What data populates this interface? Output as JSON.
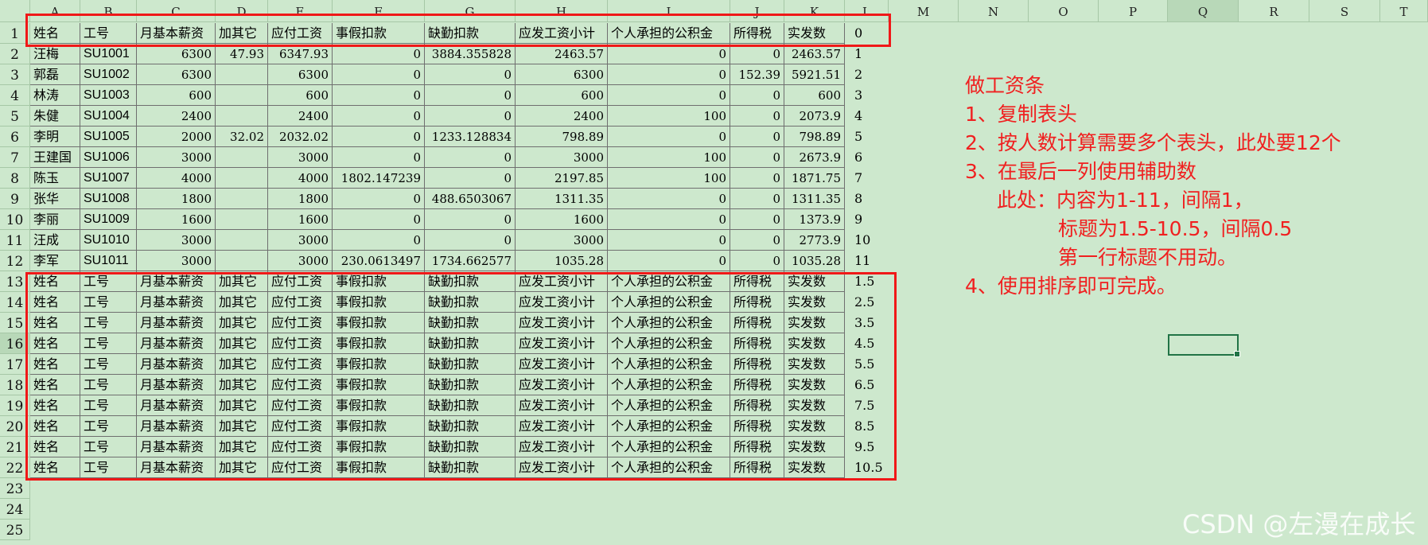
{
  "sheet": {
    "column_headers": [
      "A",
      "B",
      "C",
      "D",
      "E",
      "F",
      "G",
      "H",
      "I",
      "J",
      "K",
      "L",
      "M",
      "N",
      "O",
      "P",
      "Q",
      "R",
      "S",
      "T"
    ],
    "selected_column": "Q",
    "row_numbers": [
      "1",
      "2",
      "3",
      "4",
      "5",
      "6",
      "7",
      "8",
      "9",
      "10",
      "11",
      "12",
      "13",
      "14",
      "15",
      "16",
      "17",
      "18",
      "19",
      "20",
      "21",
      "22",
      "23",
      "24",
      "25"
    ],
    "selected_row": "16",
    "header_labels": [
      "姓名",
      "工号",
      "月基本薪资",
      "加其它",
      "应付工资",
      "事假扣款",
      "缺勤扣款",
      "应发工资小计",
      "个人承担的公积金",
      "所得税",
      "实发数"
    ],
    "data_rows": [
      {
        "name": "汪梅",
        "id": "SU1001",
        "base": "6300",
        "other": "47.93",
        "payable": "6347.93",
        "leave": "0",
        "absence": "3884.355828",
        "subtotal": "2463.57",
        "fund": "0",
        "tax": "0",
        "net": "2463.57"
      },
      {
        "name": "郭磊",
        "id": "SU1002",
        "base": "6300",
        "other": "",
        "payable": "6300",
        "leave": "0",
        "absence": "0",
        "subtotal": "6300",
        "fund": "0",
        "tax": "152.39",
        "net": "5921.51"
      },
      {
        "name": "林涛",
        "id": "SU1003",
        "base": "600",
        "other": "",
        "payable": "600",
        "leave": "0",
        "absence": "0",
        "subtotal": "600",
        "fund": "0",
        "tax": "0",
        "net": "600"
      },
      {
        "name": "朱健",
        "id": "SU1004",
        "base": "2400",
        "other": "",
        "payable": "2400",
        "leave": "0",
        "absence": "0",
        "subtotal": "2400",
        "fund": "100",
        "tax": "0",
        "net": "2073.9"
      },
      {
        "name": "李明",
        "id": "SU1005",
        "base": "2000",
        "other": "32.02",
        "payable": "2032.02",
        "leave": "0",
        "absence": "1233.128834",
        "subtotal": "798.89",
        "fund": "0",
        "tax": "0",
        "net": "798.89"
      },
      {
        "name": "王建国",
        "id": "SU1006",
        "base": "3000",
        "other": "",
        "payable": "3000",
        "leave": "0",
        "absence": "0",
        "subtotal": "3000",
        "fund": "100",
        "tax": "0",
        "net": "2673.9"
      },
      {
        "name": "陈玉",
        "id": "SU1007",
        "base": "4000",
        "other": "",
        "payable": "4000",
        "leave": "1802.147239",
        "absence": "0",
        "subtotal": "2197.85",
        "fund": "100",
        "tax": "0",
        "net": "1871.75"
      },
      {
        "name": "张华",
        "id": "SU1008",
        "base": "1800",
        "other": "",
        "payable": "1800",
        "leave": "0",
        "absence": "488.6503067",
        "subtotal": "1311.35",
        "fund": "0",
        "tax": "0",
        "net": "1311.35"
      },
      {
        "name": "李丽",
        "id": "SU1009",
        "base": "1600",
        "other": "",
        "payable": "1600",
        "leave": "0",
        "absence": "0",
        "subtotal": "1600",
        "fund": "0",
        "tax": "0",
        "net": "1373.9"
      },
      {
        "name": "汪成",
        "id": "SU1010",
        "base": "3000",
        "other": "",
        "payable": "3000",
        "leave": "0",
        "absence": "0",
        "subtotal": "3000",
        "fund": "0",
        "tax": "0",
        "net": "2773.9"
      },
      {
        "name": "李军",
        "id": "SU1011",
        "base": "3000",
        "other": "",
        "payable": "3000",
        "leave": "230.0613497",
        "absence": "1734.662577",
        "subtotal": "1035.28",
        "fund": "0",
        "tax": "0",
        "net": "1035.28"
      }
    ],
    "aux_column": [
      "0",
      "1",
      "2",
      "3",
      "4",
      "5",
      "6",
      "7",
      "8",
      "9",
      "10",
      "11",
      "1.5",
      "2.5",
      "3.5",
      "4.5",
      "5.5",
      "6.5",
      "7.5",
      "8.5",
      "9.5",
      "10.5"
    ]
  },
  "note": {
    "title": "做工资条",
    "step1": "1、复制表头",
    "step2": "2、按人数计算需要多个表头，此处要12个",
    "step3": "3、在最后一列使用辅助数",
    "detail1": "此处：内容为1-11，间隔1，",
    "detail2": "标题为1.5-10.5，间隔0.5",
    "detail3": "第一行标题不用动。",
    "step4": "4、使用排序即可完成。"
  },
  "watermark": "CSDN @左漫在成长",
  "colors": {
    "sheet_background": "#cde8cd",
    "highlight_red": "#f01818",
    "selection_green": "#217346"
  }
}
